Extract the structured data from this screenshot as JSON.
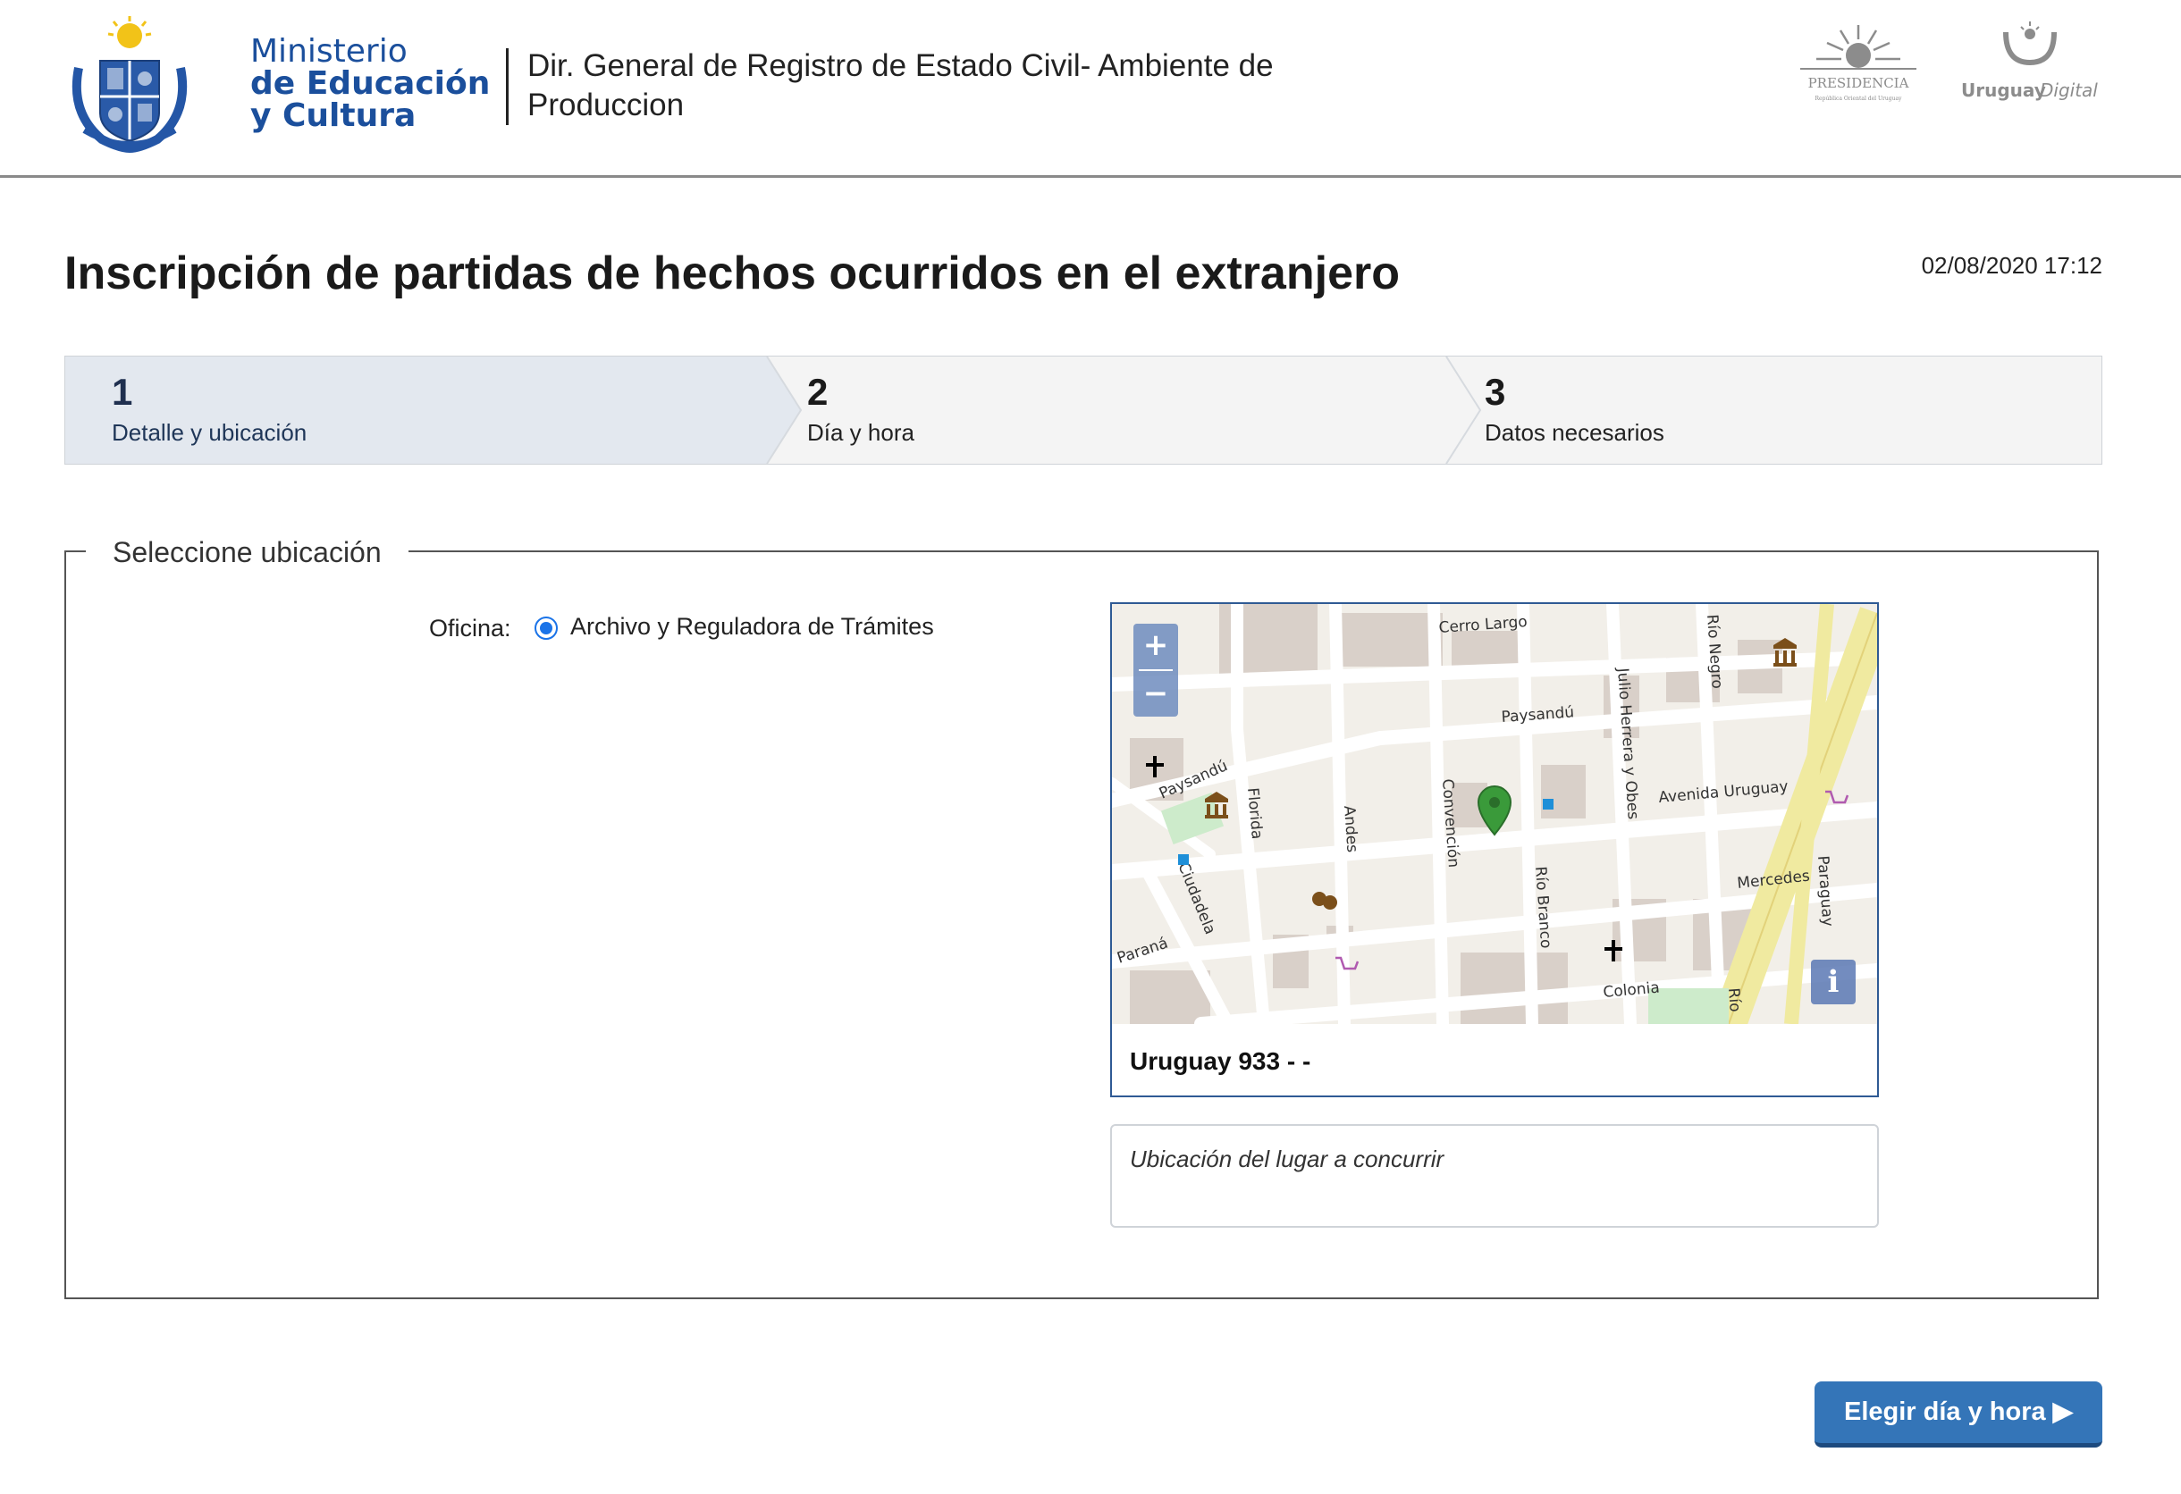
{
  "header": {
    "ministry_lines": [
      "Ministerio",
      "de Educación",
      "y Cultura"
    ],
    "office_title": "Dir. General de Registro de Estado Civil- Ambiente de Produccion",
    "presidencia_text": "PRESIDENCIA",
    "presidencia_subtext": "República Oriental del Uruguay",
    "uruguay_digital_text": "Uruguay",
    "uruguay_digital_text2": "Digital"
  },
  "page": {
    "title": "Inscripción de partidas de hechos ocurridos en el extranjero",
    "datetime": "02/08/2020 17:12"
  },
  "steps": [
    {
      "number": "1",
      "label": "Detalle y ubicación",
      "active": true
    },
    {
      "number": "2",
      "label": "Día y hora",
      "active": false
    },
    {
      "number": "3",
      "label": "Datos necesarios",
      "active": false
    }
  ],
  "location": {
    "legend": "Seleccione ubicación",
    "oficina_label": "Oficina:",
    "oficina_option": "Archivo y Reguladora de Trámites",
    "oficina_selected": true,
    "address": "Uruguay 933 - -",
    "textarea_placeholder": "Ubicación del lugar a concurrir"
  },
  "map": {
    "zoom_in": "+",
    "zoom_out": "−",
    "info": "i",
    "streets": [
      "Cerro Largo",
      "Paysandú",
      "Paysandú",
      "Avenida Uruguay",
      "Mercedes",
      "Colonia",
      "Paraná",
      "Ciudadela",
      "Florida",
      "Andes",
      "Convención",
      "Río Branco",
      "Julio Herrera y Obes",
      "Río Negro",
      "Paraguay",
      "Río"
    ]
  },
  "actions": {
    "next_label": "Elegir día y hora ▶"
  },
  "colors": {
    "accent": "#3475b8",
    "active_step_bg": "#e3e8ef",
    "marker": "#3a9a3a"
  }
}
